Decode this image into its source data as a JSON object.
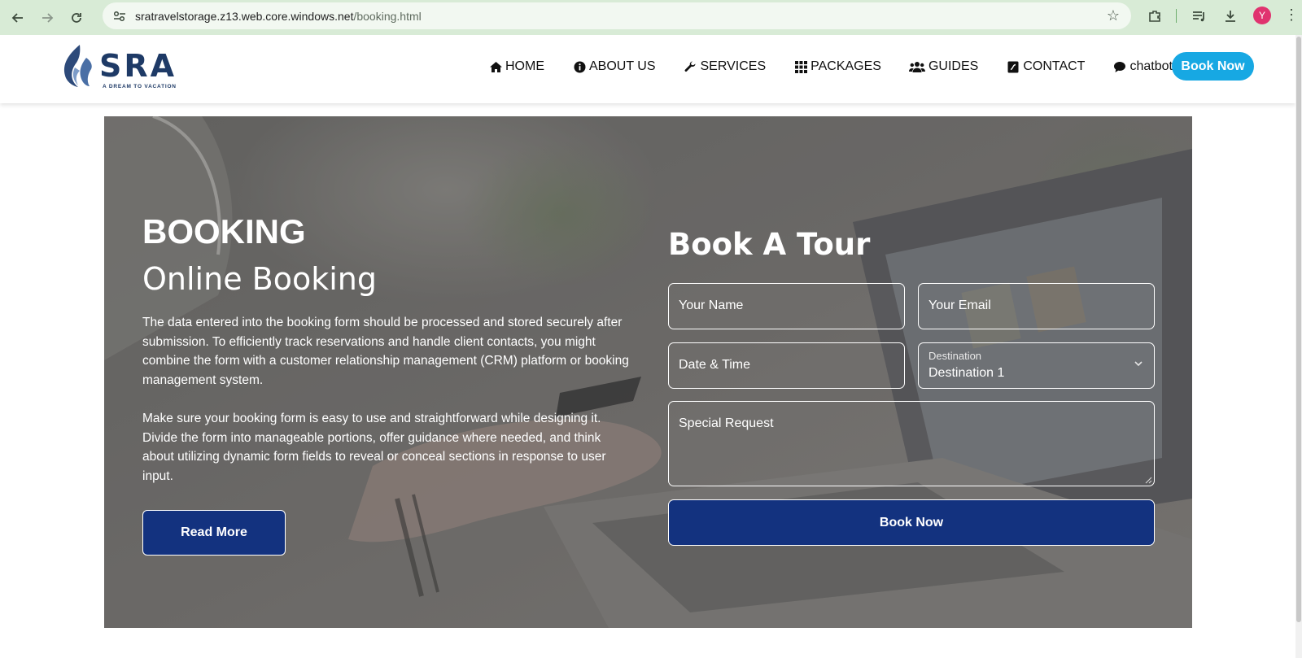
{
  "browser": {
    "url_host": "sratravelstorage.z13.web.core.windows.net",
    "url_path": "/booking.html",
    "profile_initial": "Y"
  },
  "header": {
    "logo_name": "SRA",
    "logo_tagline": "A DREAM TO VACATION",
    "nav": [
      {
        "label": "HOME",
        "icon": "home-icon"
      },
      {
        "label": "ABOUT US",
        "icon": "info-icon"
      },
      {
        "label": "SERVICES",
        "icon": "wrench-icon"
      },
      {
        "label": "PACKAGES",
        "icon": "grid-icon"
      },
      {
        "label": "GUIDES",
        "icon": "users-icon"
      },
      {
        "label": "CONTACT",
        "icon": "contact-book-icon"
      },
      {
        "label": "chatbot",
        "icon": "chat-bubble-icon"
      }
    ],
    "cta_label": "Book Now",
    "cta_color": "#17a8e3"
  },
  "hero": {
    "title": "BOOKING",
    "subtitle": "Online Booking",
    "paragraph1": "The data entered into the booking form should be processed and stored securely after submission. To efficiently track reservations and handle client contacts, you might combine the form with a customer relationship management (CRM) platform or booking management system.",
    "paragraph2": "Make sure your booking form is easy to use and straightforward while designing it. Divide the form into manageable portions, offer guidance where needed, and think about utilizing dynamic form fields to reveal or conceal sections in response to user input.",
    "read_more_label": "Read More",
    "button_color": "#13327f"
  },
  "form": {
    "title": "Book A Tour",
    "name_placeholder": "Your Name",
    "email_placeholder": "Your Email",
    "datetime_placeholder": "Date & Time",
    "destination_label": "Destination",
    "destination_value": "Destination 1",
    "request_placeholder": "Special Request",
    "submit_label": "Book Now"
  }
}
